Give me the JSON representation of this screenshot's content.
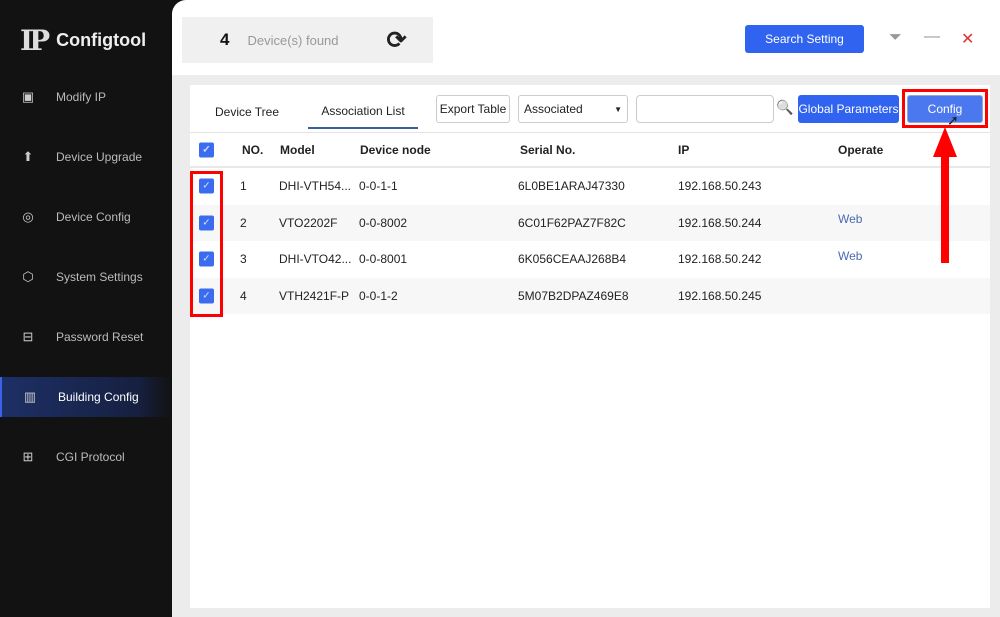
{
  "app": {
    "logo_mark": "IP",
    "title": "Configtool"
  },
  "sidebar": {
    "items": [
      {
        "label": "Modify IP",
        "icon": "ip-icon",
        "glyph": "▣"
      },
      {
        "label": "Device Upgrade",
        "icon": "upload-icon",
        "glyph": "⬆"
      },
      {
        "label": "Device Config",
        "icon": "target-icon",
        "glyph": "◎"
      },
      {
        "label": "System Settings",
        "icon": "gear-icon",
        "glyph": "⬡"
      },
      {
        "label": "Password Reset",
        "icon": "lock-icon",
        "glyph": "⊟"
      },
      {
        "label": "Building Config",
        "icon": "building-icon",
        "glyph": "▥",
        "active": true
      },
      {
        "label": "CGI Protocol",
        "icon": "grid-icon",
        "glyph": "⊞"
      }
    ]
  },
  "header": {
    "count": "4",
    "count_label": "Device(s) found",
    "refresh_glyph": "⟳",
    "search_setting": "Search Setting",
    "filter_glyph": "⏷",
    "minimize_glyph": "—",
    "close_glyph": "✕"
  },
  "toolbar": {
    "tabs": [
      "Device Tree",
      "Association List"
    ],
    "active_tab": "Association List",
    "export": "Export Table",
    "filter_value": "Associated",
    "search_value": "",
    "search_glyph": "🔍",
    "global_params": "Global Parameters",
    "config": "Config"
  },
  "table": {
    "columns": [
      "NO.",
      "Model",
      "Device node",
      "Serial No.",
      "IP",
      "Operate"
    ],
    "rows": [
      {
        "no": "1",
        "model": "DHI-VTH54...",
        "node": "0-0-1-1",
        "serial": "6L0BE1ARAJ47330",
        "ip": "192.168.50.243",
        "operate": "",
        "checked": true
      },
      {
        "no": "2",
        "model": "VTO2202F",
        "node": "0-0-8002",
        "serial": "6C01F62PAZ7F82C",
        "ip": "192.168.50.244",
        "operate": "Web",
        "checked": true
      },
      {
        "no": "3",
        "model": "DHI-VTO42...",
        "node": "0-0-8001",
        "serial": "6K056CEAAJ268B4",
        "ip": "192.168.50.242",
        "operate": "Web",
        "checked": true
      },
      {
        "no": "4",
        "model": "VTH2421F-P",
        "node": "0-0-1-2",
        "serial": "5M07B2DPAZ469E8",
        "ip": "192.168.50.245",
        "operate": "",
        "checked": true
      }
    ]
  },
  "colors": {
    "accent": "#2f63f0",
    "annotation": "#ff0000",
    "sidebar_bg": "#121212"
  }
}
